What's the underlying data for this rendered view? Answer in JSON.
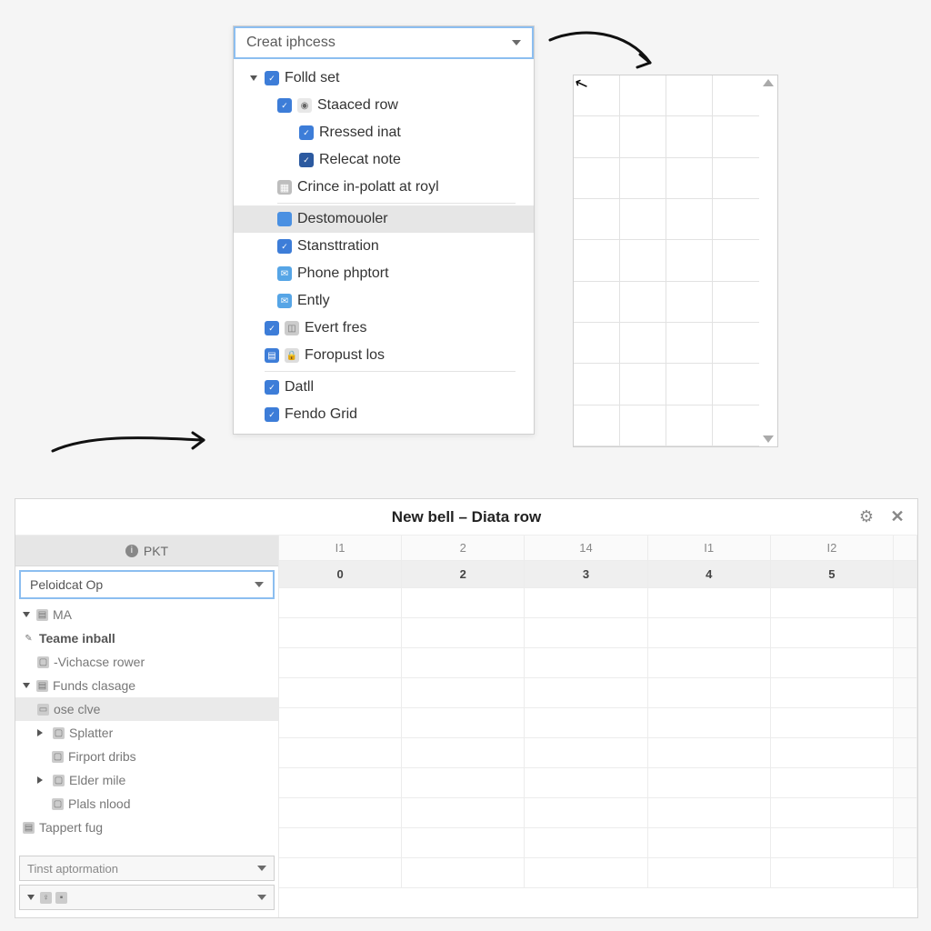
{
  "top": {
    "dropdown_label": "Creat iphcess",
    "tree": [
      {
        "label": "Folld set"
      },
      {
        "label": "Staaced row"
      },
      {
        "label": "Rressed inat"
      },
      {
        "label": "Relecat note"
      },
      {
        "label": "Crince in-polatt at royl"
      },
      {
        "label": "Destomouoler"
      },
      {
        "label": "Stansttration"
      },
      {
        "label": "Phone phptort"
      },
      {
        "label": "Ently"
      },
      {
        "label": "Evert fres"
      },
      {
        "label": "Foropust los"
      },
      {
        "label": "Datll"
      },
      {
        "label": "Fendo Grid"
      }
    ]
  },
  "bottom": {
    "title": "New bell – Diata row",
    "tab_label": "PKT",
    "select1": "Peloidcat Op",
    "select2": "Tinst aptormation",
    "select3": "",
    "tree": [
      {
        "label": "MA"
      },
      {
        "label": "Teame inball"
      },
      {
        "label": "-Vichacse rower"
      },
      {
        "label": "Funds clasage"
      },
      {
        "label": "ose clve"
      },
      {
        "label": "Splatter"
      },
      {
        "label": "Firport dribs"
      },
      {
        "label": "Elder mile"
      },
      {
        "label": "Plals nlood"
      },
      {
        "label": "Tappert fug"
      }
    ],
    "cols_top": [
      "I1",
      "2",
      "14",
      "I1",
      "I2"
    ],
    "cols_main": [
      "0",
      "2",
      "3",
      "4",
      "5"
    ]
  }
}
